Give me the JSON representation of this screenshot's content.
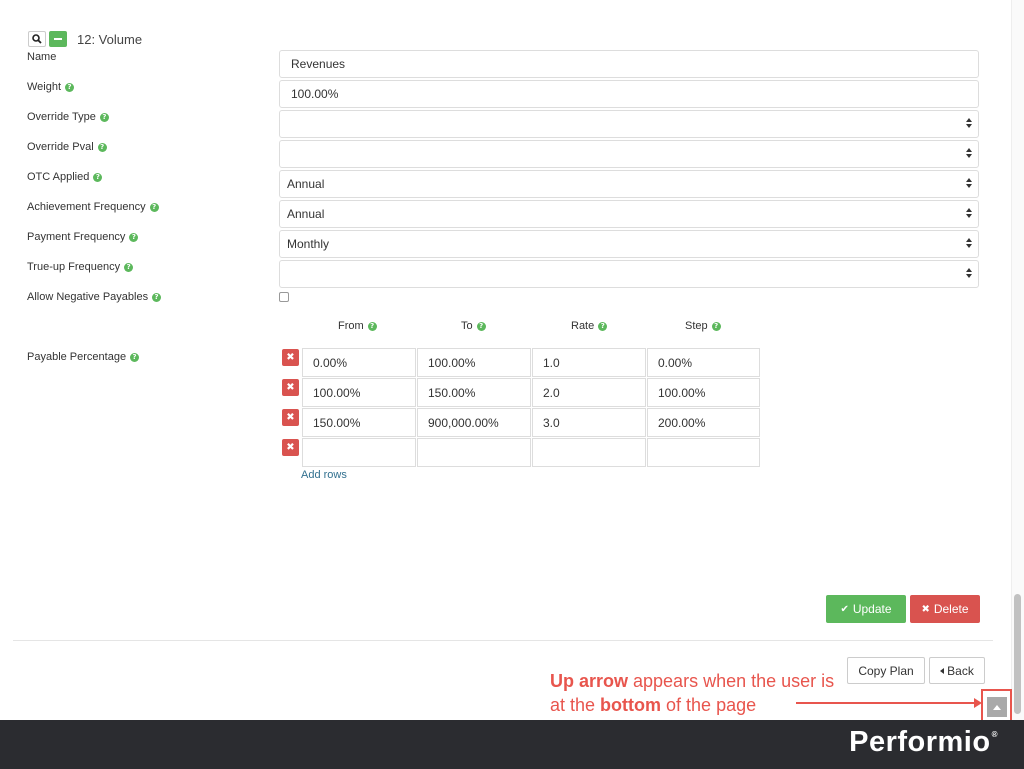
{
  "header": {
    "title": "12: Volume"
  },
  "form": {
    "name": {
      "label": "Name",
      "value": "Revenues"
    },
    "weight": {
      "label": "Weight",
      "value": "100.00%"
    },
    "override_type": {
      "label": "Override Type",
      "value": ""
    },
    "override_pval": {
      "label": "Override Pval",
      "value": ""
    },
    "otc_applied": {
      "label": "OTC Applied",
      "value": "Annual"
    },
    "achievement_frequency": {
      "label": "Achievement Frequency",
      "value": "Annual"
    },
    "payment_frequency": {
      "label": "Payment Frequency",
      "value": "Monthly"
    },
    "trueup_frequency": {
      "label": "True-up Frequency",
      "value": ""
    },
    "allow_negative_payables": {
      "label": "Allow Negative Payables",
      "checked": false
    },
    "payable_percentage": {
      "label": "Payable Percentage"
    }
  },
  "table": {
    "columns": [
      "From",
      "To",
      "Rate",
      "Step"
    ],
    "rows": [
      [
        "0.00%",
        "100.00%",
        "1.0",
        "0.00%"
      ],
      [
        "100.00%",
        "150.00%",
        "2.0",
        "100.00%"
      ],
      [
        "150.00%",
        "900,000.00%",
        "3.0",
        "200.00%"
      ],
      [
        "",
        "",
        "",
        ""
      ]
    ],
    "add_rows_label": "Add rows"
  },
  "actions": {
    "update_label": "Update",
    "delete_label": "Delete"
  },
  "footer_actions": {
    "copy_plan_label": "Copy Plan",
    "back_label": "Back"
  },
  "annotation": {
    "part1_bold": "Up arrow",
    "part2": " appears when the user is at the ",
    "part3_bold": "bottom",
    "part4": " of the page"
  },
  "brand": {
    "logo_text": "Performio",
    "registered": "®"
  },
  "colors": {
    "success": "#5cb85c",
    "danger": "#d9534f",
    "annotation": "#e8554d",
    "footer": "#2b2c30"
  },
  "icons": {
    "search": "search-icon",
    "collapse": "minus-icon",
    "help": "question-circle-icon",
    "remove": "times-icon",
    "check": "check-icon",
    "back": "caret-left-icon",
    "scroll_top": "chevron-up-icon"
  }
}
